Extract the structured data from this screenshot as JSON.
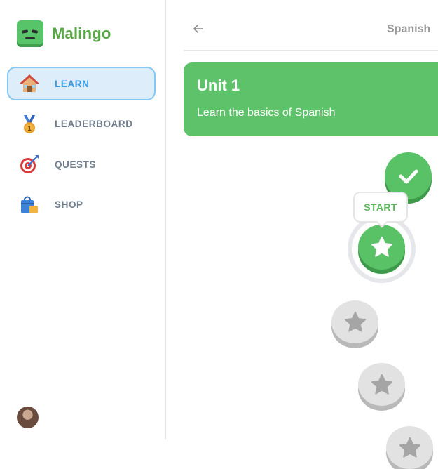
{
  "app": {
    "name": "Malingo"
  },
  "sidebar": {
    "items": [
      {
        "label": "LEARN",
        "icon": "house-icon",
        "active": true
      },
      {
        "label": "LEADERBOARD",
        "icon": "medal-icon",
        "active": false
      },
      {
        "label": "QUESTS",
        "icon": "target-icon",
        "active": false
      },
      {
        "label": "SHOP",
        "icon": "shopping-bag-icon",
        "active": false
      }
    ],
    "avatar": "user-avatar"
  },
  "header": {
    "course": "Spanish",
    "back_icon": "arrow-left-icon"
  },
  "unit": {
    "title": "Unit 1",
    "subtitle": "Learn the basics of Spanish"
  },
  "path": {
    "start_label": "START",
    "nodes": [
      {
        "state": "completed",
        "icon": "check-icon"
      },
      {
        "state": "current",
        "icon": "star-icon"
      },
      {
        "state": "locked",
        "icon": "star-icon"
      },
      {
        "state": "locked",
        "icon": "star-icon"
      },
      {
        "state": "locked",
        "icon": "star-icon"
      }
    ]
  },
  "colors": {
    "accent_green": "#59c166",
    "active_blue": "#3a9be0",
    "locked_gray": "#e2e2e2"
  }
}
